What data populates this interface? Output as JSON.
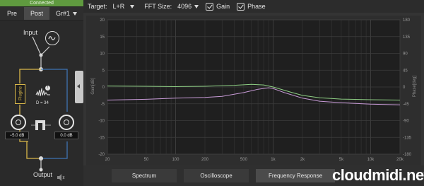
{
  "connection": {
    "status": "Connected",
    "color": "#5f9a3f"
  },
  "tabs": [
    {
      "label": "Pre"
    },
    {
      "label": "Post"
    },
    {
      "label": "Gr#1"
    }
  ],
  "routing": {
    "input_label": "Input",
    "output_label": "Output",
    "plugins_label": "Plugins",
    "delay_label": "D = 34",
    "left_gain": "−5.0 dB",
    "right_gain": "0.0 dB"
  },
  "toolbar": {
    "target_label": "Target:",
    "target_value": "L+R",
    "fft_label": "FFT Size:",
    "fft_value": "4096",
    "gain_label": "Gain",
    "gain_checked": true,
    "phase_label": "Phase",
    "phase_checked": true
  },
  "chart_data": {
    "type": "line",
    "x_scale": "log",
    "xlim": [
      20,
      20000
    ],
    "x_ticks": [
      "20",
      "50",
      "100",
      "200",
      "500",
      "1k",
      "2k",
      "5k",
      "10k",
      "20k"
    ],
    "y_left": {
      "label": "Gain[dB]",
      "ylim": [
        -20,
        20
      ],
      "ticks": [
        "20",
        "15",
        "10",
        "5",
        "0",
        "-5",
        "-10",
        "-15",
        "-20"
      ]
    },
    "y_right": {
      "label": "Phase[deg]",
      "ylim": [
        -180,
        180
      ],
      "ticks": [
        "180",
        "135",
        "90",
        "45",
        "0",
        "-45",
        "-90",
        "-135",
        "-180"
      ]
    },
    "grid": true,
    "series": [
      {
        "axis": "left",
        "color": "#8ecf84",
        "x": [
          20,
          50,
          100,
          200,
          400,
          600,
          800,
          1000,
          1500,
          2000,
          3000,
          5000,
          10000,
          20000
        ],
        "y": [
          0.3,
          0.2,
          0.1,
          0.2,
          0.5,
          0.8,
          0.6,
          0,
          -1.5,
          -2.5,
          -3.2,
          -3.6,
          -3.8,
          -3.9
        ]
      },
      {
        "axis": "right",
        "color": "#c79ad6",
        "x": [
          20,
          50,
          100,
          200,
          300,
          500,
          700,
          900,
          1000,
          1300,
          2000,
          3000,
          5000,
          10000,
          20000
        ],
        "y": [
          -35,
          -33,
          -30,
          -28,
          -25,
          -15,
          -6,
          -2,
          -4,
          -15,
          -30,
          -38,
          -42,
          -46,
          -48
        ]
      }
    ]
  },
  "bottom_tabs": [
    {
      "label": "Spectrum"
    },
    {
      "label": "Oscilloscope"
    },
    {
      "label": "Frequency Response"
    }
  ],
  "watermark": "cloudmidi.net"
}
